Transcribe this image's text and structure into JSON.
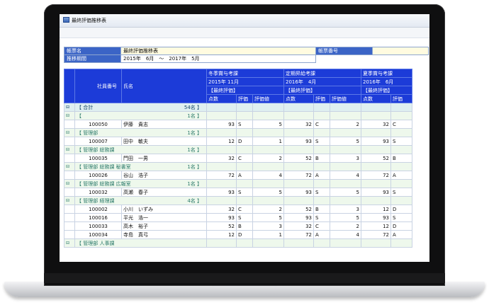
{
  "window": {
    "title": "最終評価推移表"
  },
  "form": {
    "report_name_label": "帳票名",
    "report_name_value": "最終評価推移表",
    "report_no_label": "帳票番号",
    "report_no_value": "",
    "period_label": "推移期間",
    "period_value": "2015年　6月　～　2017年　5月"
  },
  "table": {
    "left_headers": {
      "emp_no": "社員番号",
      "name": "氏名"
    },
    "periods": [
      {
        "title": "冬季賞与考課",
        "date": "2015年 11月",
        "eval_label": "【最終評価】"
      },
      {
        "title": "定期昇給考課",
        "date": "2016年　4月",
        "eval_label": "【最終評価】"
      },
      {
        "title": "夏季賞与考課",
        "date": "2016年　6月",
        "eval_label": "【最終評価】"
      }
    ],
    "sub_headers": {
      "score": "点数",
      "rating": "評価",
      "rating_value": "評価値"
    },
    "rows": [
      {
        "kind": "total",
        "expander": "⊟",
        "label": "【 合計",
        "count": "54名 】"
      },
      {
        "kind": "group",
        "expander": "⊟",
        "label": "【",
        "count": "1名 】"
      },
      {
        "kind": "emp",
        "no": "100050",
        "name": "伊藤　貴志",
        "p1_score": "93",
        "p1_rating": "S",
        "p1_value": "5",
        "p2_score": "32",
        "p2_rating": "C",
        "p2_value": "2",
        "p3_score": "32",
        "p3_rating": "C"
      },
      {
        "kind": "group",
        "expander": "⊟",
        "label": "【 管理部",
        "count": "1名 】"
      },
      {
        "kind": "emp",
        "no": "100007",
        "name": "田中　敏夫",
        "p1_score": "12",
        "p1_rating": "D",
        "p1_value": "1",
        "p2_score": "93",
        "p2_rating": "S",
        "p2_value": "5",
        "p3_score": "93",
        "p3_rating": "S"
      },
      {
        "kind": "group",
        "expander": "⊟",
        "label": "【 管理部 総務課",
        "count": "1名 】"
      },
      {
        "kind": "emp",
        "no": "100035",
        "name": "門田　一男",
        "p1_score": "32",
        "p1_rating": "C",
        "p1_value": "2",
        "p2_score": "52",
        "p2_rating": "B",
        "p2_value": "3",
        "p3_score": "52",
        "p3_rating": "B"
      },
      {
        "kind": "group",
        "expander": "⊟",
        "label": "【 管理部 総務課 秘書室",
        "count": "1名 】"
      },
      {
        "kind": "emp",
        "no": "100026",
        "name": "谷山　浩子",
        "p1_score": "72",
        "p1_rating": "A",
        "p1_value": "4",
        "p2_score": "72",
        "p2_rating": "A",
        "p2_value": "4",
        "p3_score": "72",
        "p3_rating": "A"
      },
      {
        "kind": "group",
        "expander": "⊟",
        "label": "【 管理部 総務課 広報室",
        "count": "1名 】"
      },
      {
        "kind": "emp",
        "no": "100032",
        "name": "高瀬　春子",
        "p1_score": "93",
        "p1_rating": "S",
        "p1_value": "5",
        "p2_score": "93",
        "p2_rating": "S",
        "p2_value": "5",
        "p3_score": "93",
        "p3_rating": "S"
      },
      {
        "kind": "group",
        "expander": "⊟",
        "label": "【 管理部 経理課",
        "count": "4名 】"
      },
      {
        "kind": "emp",
        "no": "100002",
        "name": "小川　いずみ",
        "p1_score": "32",
        "p1_rating": "C",
        "p1_value": "2",
        "p2_score": "52",
        "p2_rating": "B",
        "p2_value": "3",
        "p3_score": "12",
        "p3_rating": "D"
      },
      {
        "kind": "emp",
        "no": "100016",
        "name": "平光　浩一",
        "p1_score": "93",
        "p1_rating": "S",
        "p1_value": "5",
        "p2_score": "93",
        "p2_rating": "S",
        "p2_value": "5",
        "p3_score": "93",
        "p3_rating": "S"
      },
      {
        "kind": "emp",
        "no": "100033",
        "name": "高木　裕子",
        "p1_score": "52",
        "p1_rating": "B",
        "p1_value": "3",
        "p2_score": "32",
        "p2_rating": "C",
        "p2_value": "2",
        "p3_score": "12",
        "p3_rating": "D"
      },
      {
        "kind": "emp",
        "no": "100034",
        "name": "寺島　真弓",
        "p1_score": "12",
        "p1_rating": "D",
        "p1_value": "1",
        "p2_score": "72",
        "p2_rating": "A",
        "p2_value": "4",
        "p3_score": "72",
        "p3_rating": "A"
      },
      {
        "kind": "group",
        "expander": "⊟",
        "label": "【 管理部 人事課",
        "count": ""
      }
    ]
  },
  "colors": {
    "header_blue": "#1c3bd8",
    "label_blue": "#3b64c6",
    "value_yellow": "#fffbe0",
    "group_green": "#eef8ec"
  }
}
